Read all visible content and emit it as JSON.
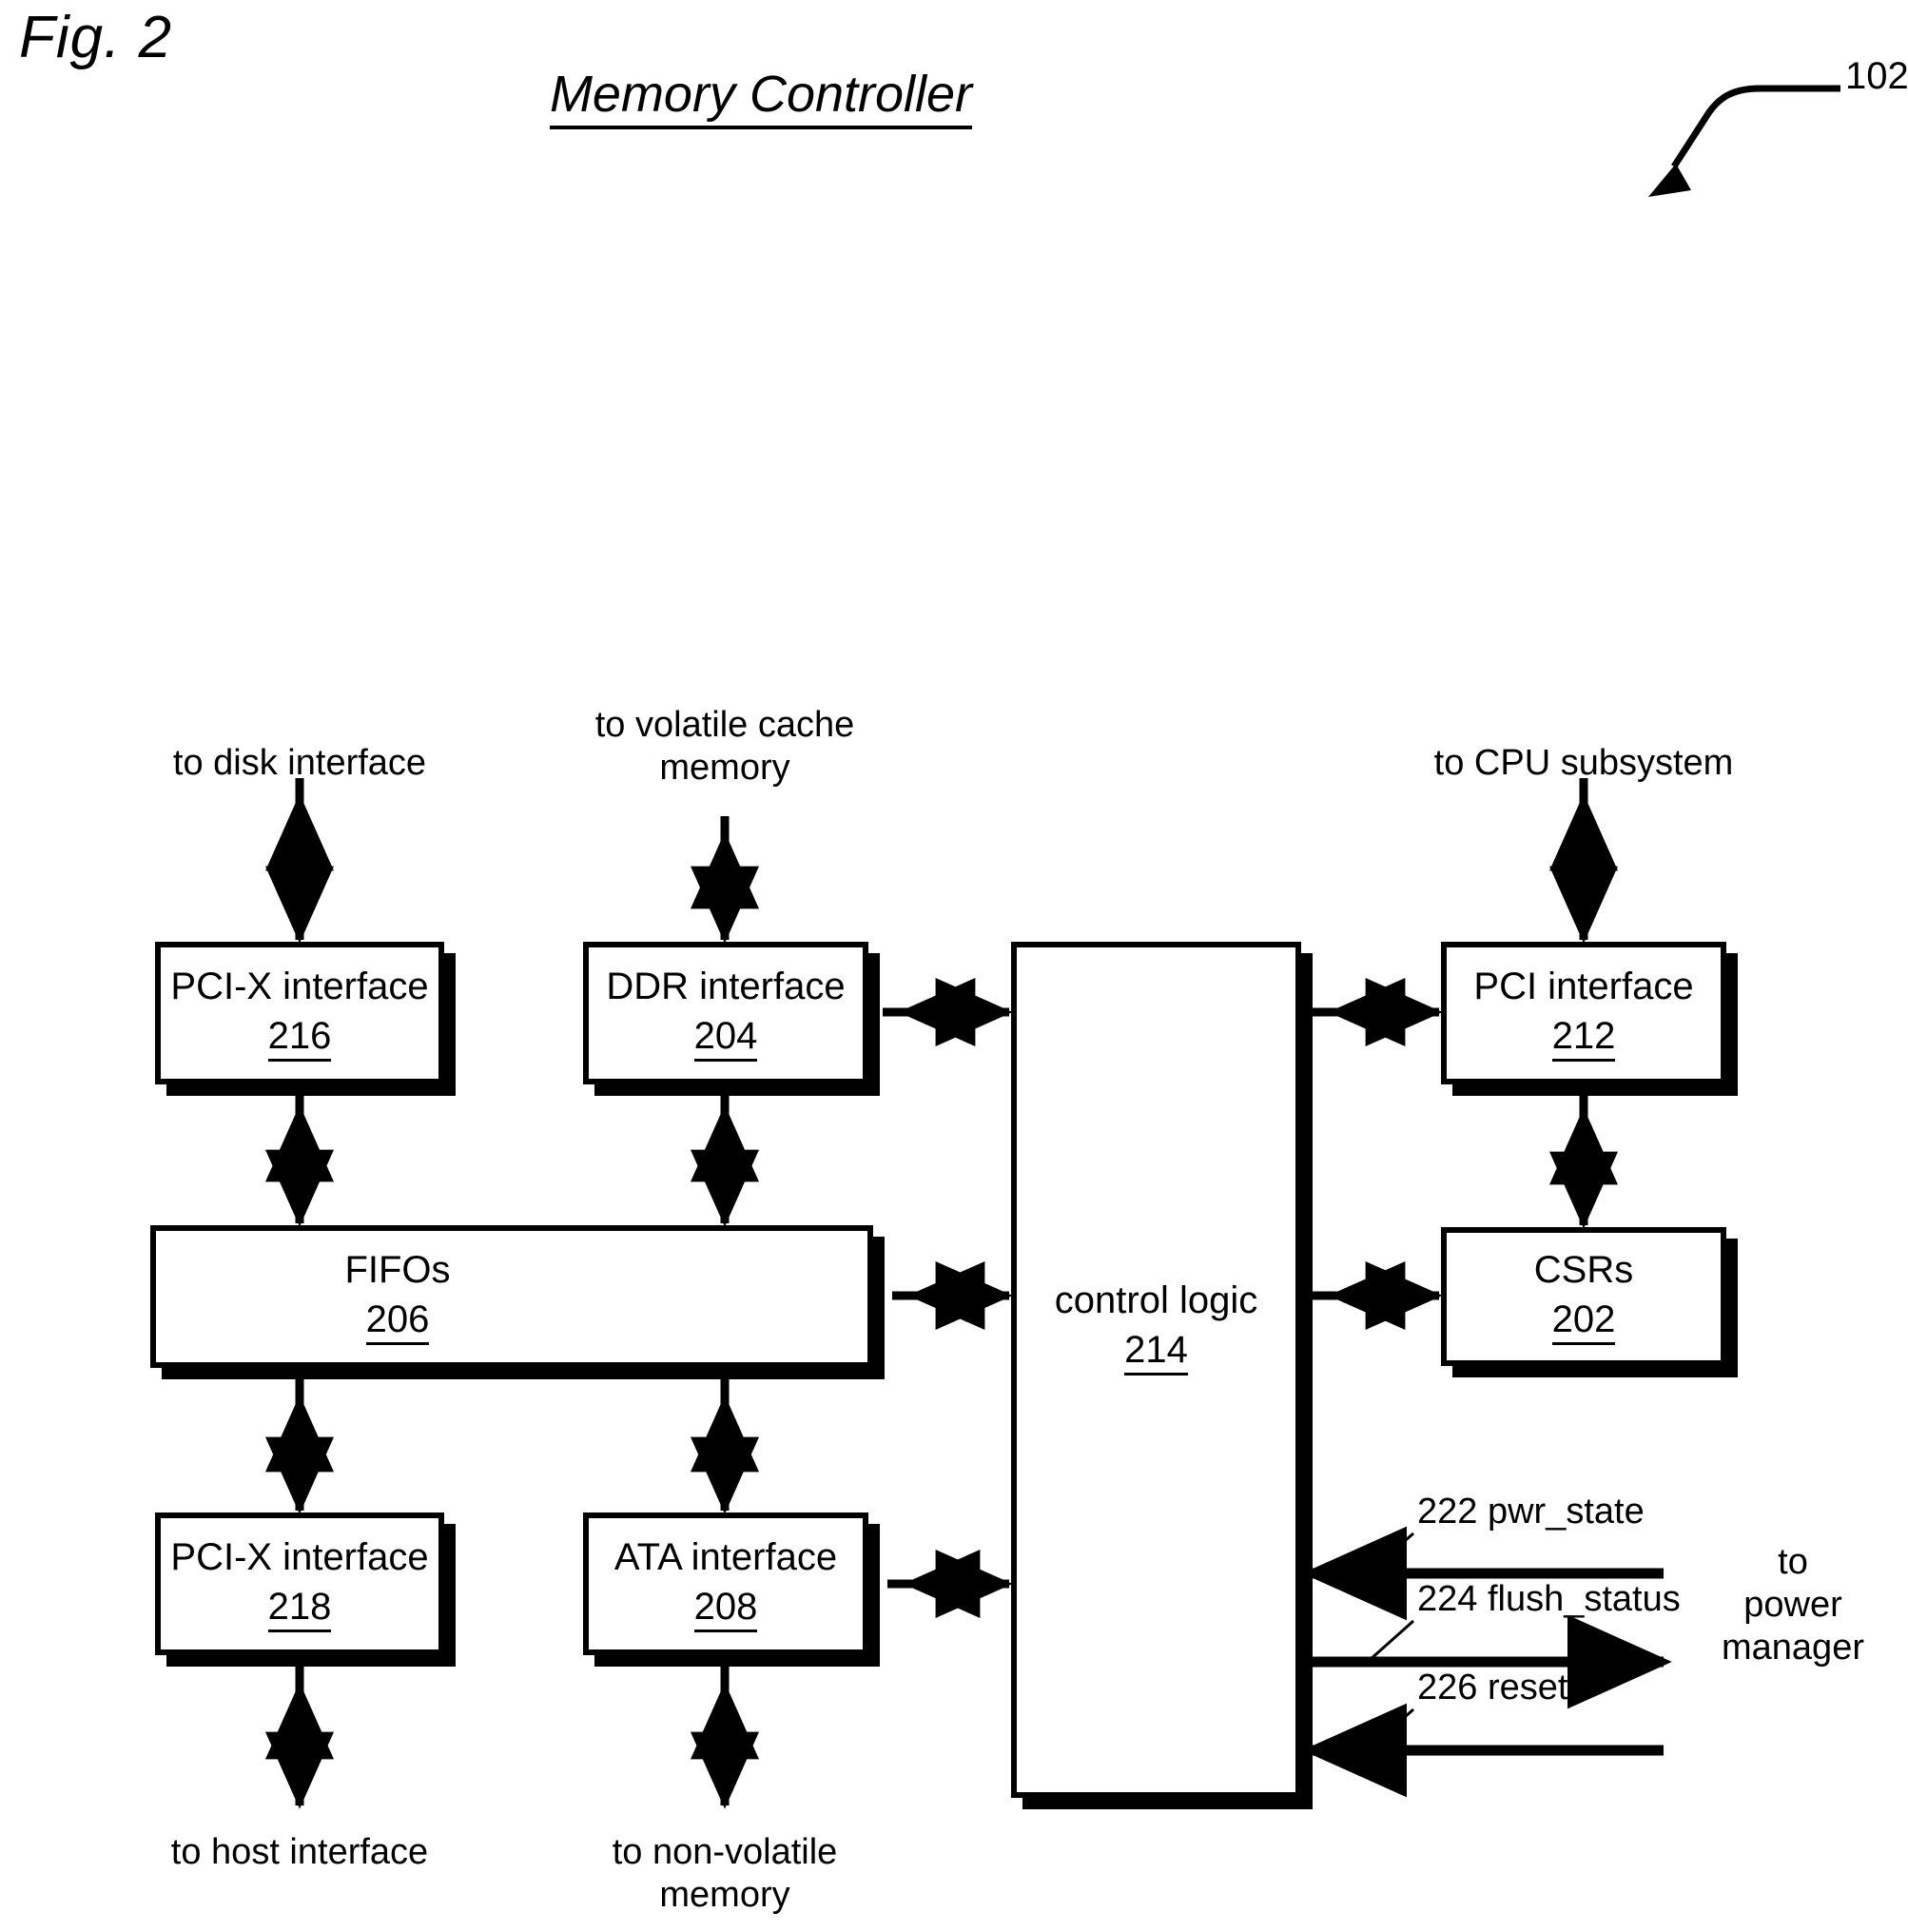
{
  "figure": {
    "label": "Fig. 2",
    "title": "Memory Controller",
    "ref_number": "102"
  },
  "blocks": [
    {
      "id": "pcix216",
      "title": "PCI-X interface",
      "number": "216"
    },
    {
      "id": "ddr204",
      "title": "DDR interface",
      "number": "204"
    },
    {
      "id": "pci212",
      "title": "PCI interface",
      "number": "212"
    },
    {
      "id": "fifos206",
      "title": "FIFOs",
      "number": "206"
    },
    {
      "id": "csrs202",
      "title": "CSRs",
      "number": "202"
    },
    {
      "id": "pcix218",
      "title": "PCI-X interface",
      "number": "218"
    },
    {
      "id": "ata208",
      "title": "ATA interface",
      "number": "208"
    },
    {
      "id": "ctrl214",
      "title": "control logic",
      "number": "214"
    }
  ],
  "io_labels": {
    "disk_interface": "to disk interface",
    "volatile_cache_line1": "to volatile cache",
    "volatile_cache_line2": "memory",
    "cpu_subsystem": "to CPU subsystem",
    "host_interface": "to host interface",
    "nonvolatile_line1": "to non-volatile",
    "nonvolatile_line2": "memory",
    "power_manager_line1": "to",
    "power_manager_line2": "power",
    "power_manager_line3": "manager"
  },
  "signals": [
    {
      "ref": "222",
      "name": "pwr_state",
      "label": "222 pwr_state",
      "direction": "in"
    },
    {
      "ref": "224",
      "name": "flush_status",
      "label": "224 flush_status",
      "direction": "out"
    },
    {
      "ref": "226",
      "name": "reset",
      "label": "226 reset",
      "direction": "in"
    }
  ],
  "colors": {
    "line": "#000000",
    "background": "#ffffff"
  }
}
